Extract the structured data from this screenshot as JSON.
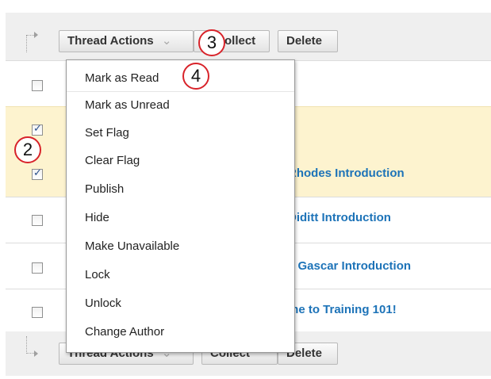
{
  "toolbar_top": {
    "thread_actions": "Thread Actions",
    "chevron": "»",
    "collect": "Collect",
    "collect_partial": "ollect",
    "delete": "Delete"
  },
  "toolbar_bottom": {
    "thread_actions": "Thread Actions",
    "collect": "Collect",
    "delete": "Delete"
  },
  "rows": [
    {
      "checked": false,
      "title": ""
    },
    {
      "checked": true,
      "title": ""
    },
    {
      "checked": true,
      "title": "Rhodes Introduction"
    },
    {
      "checked": false,
      "title": "Diditt Introduction"
    },
    {
      "checked": false,
      "title": "e Gascar Introduction"
    },
    {
      "checked": false,
      "title": "me to Training 101!"
    }
  ],
  "menu": {
    "items": [
      "Mark as Read",
      "Mark as Unread",
      "Set Flag",
      "Clear Flag",
      "Publish",
      "Hide",
      "Make Unavailable",
      "Lock",
      "Unlock",
      "Change Author"
    ]
  },
  "callouts": {
    "c2": "2",
    "c3": "3",
    "c4": "4"
  },
  "colors": {
    "accent_link": "#1d73b8",
    "selected_row": "#fdf3cf",
    "callout_border": "#d8232a"
  }
}
